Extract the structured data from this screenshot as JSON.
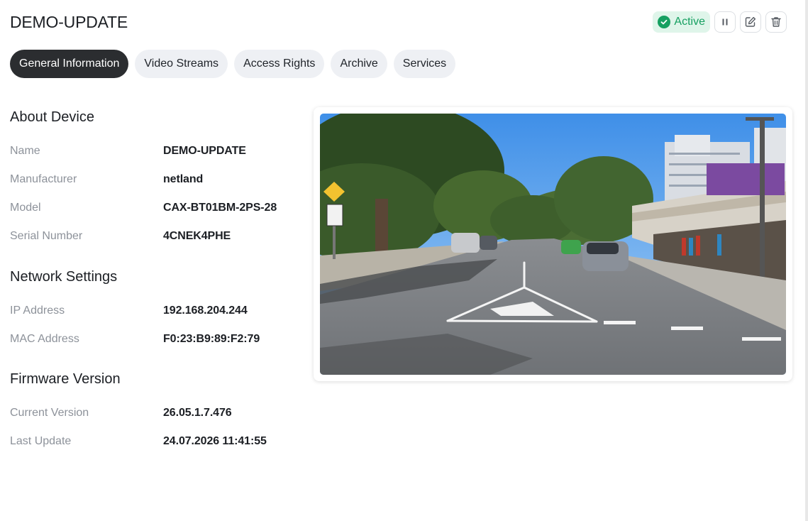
{
  "device": {
    "title": "DEMO-UPDATE",
    "status_label": "Active"
  },
  "tabs": [
    {
      "label": "General Information",
      "active": true
    },
    {
      "label": "Video Streams",
      "active": false
    },
    {
      "label": "Access Rights",
      "active": false
    },
    {
      "label": "Archive",
      "active": false
    },
    {
      "label": "Services",
      "active": false
    }
  ],
  "about": {
    "title": "About Device",
    "name_label": "Name",
    "name_value": "DEMO-UPDATE",
    "manufacturer_label": "Manufacturer",
    "manufacturer_value": "netland",
    "model_label": "Model",
    "model_value": "CAX-BT01BM-2PS-28",
    "serial_label": "Serial Number",
    "serial_value": "4CNEK4PHE"
  },
  "network": {
    "title": "Network Settings",
    "ip_label": "IP Address",
    "ip_value": "192.168.204.244",
    "mac_label": "MAC Address",
    "mac_value": "F0:23:B9:89:F2:79"
  },
  "firmware": {
    "title": "Firmware Version",
    "current_label": "Current Version",
    "current_value": "26.05.1.7.476",
    "last_update_label": "Last Update",
    "last_update_value": "24.07.2026 11:41:55"
  },
  "icons": {
    "status": "check-circle-icon",
    "pause": "pause-icon",
    "edit": "edit-icon",
    "delete": "trash-icon"
  },
  "colors": {
    "active_green": "#16a061",
    "active_bg": "#dff5ea",
    "tab_active_bg": "#2b2d30",
    "tab_bg": "#eef0f4"
  }
}
